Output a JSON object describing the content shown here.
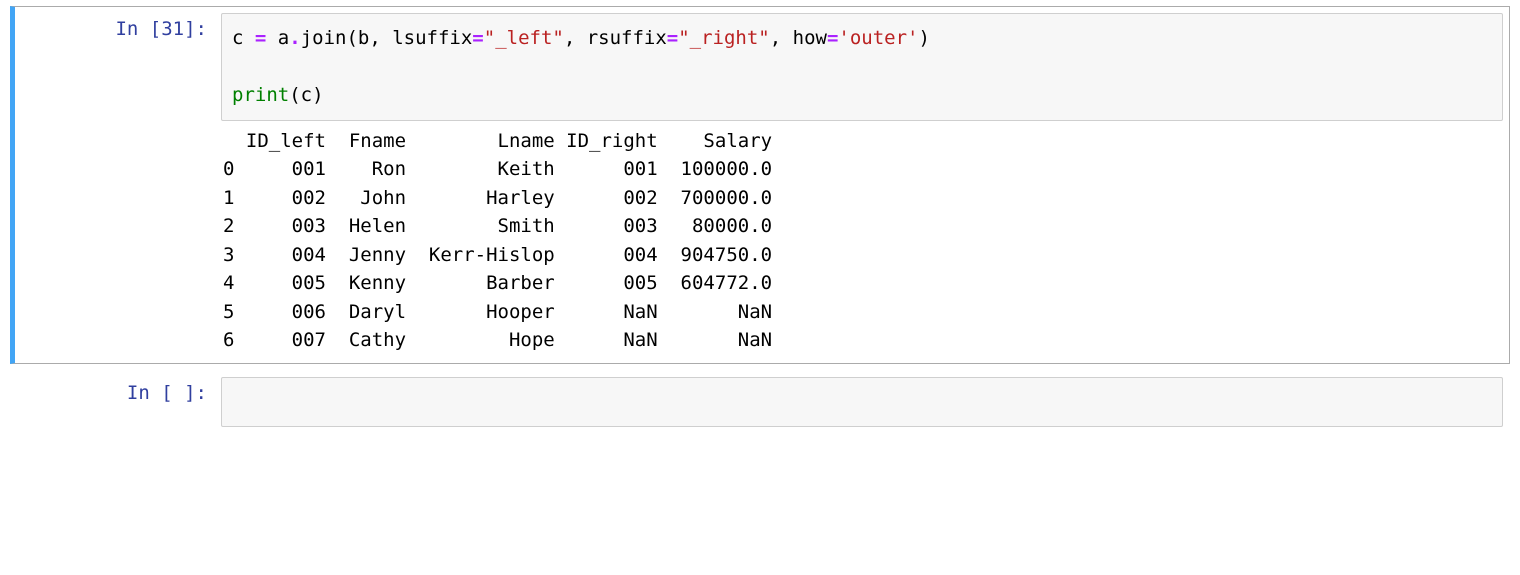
{
  "cells": [
    {
      "prompt": "In [31]:",
      "code_tokens": [
        {
          "t": "c",
          "c": "tok-name"
        },
        {
          "t": " ",
          "c": "tok"
        },
        {
          "t": "=",
          "c": "tok-op"
        },
        {
          "t": " a",
          "c": "tok-name"
        },
        {
          "t": ".",
          "c": "tok-op"
        },
        {
          "t": "join(b, lsuffix",
          "c": "tok-name"
        },
        {
          "t": "=",
          "c": "tok-op"
        },
        {
          "t": "\"_left\"",
          "c": "tok-str"
        },
        {
          "t": ", rsuffix",
          "c": "tok-name"
        },
        {
          "t": "=",
          "c": "tok-op"
        },
        {
          "t": "\"_right\"",
          "c": "tok-str"
        },
        {
          "t": ", how",
          "c": "tok-name"
        },
        {
          "t": "=",
          "c": "tok-op"
        },
        {
          "t": "'outer'",
          "c": "tok-str"
        },
        {
          "t": ")",
          "c": "tok-name"
        },
        {
          "t": "\n\n",
          "c": "tok"
        },
        {
          "t": "print",
          "c": "tok-builtin"
        },
        {
          "t": "(c)",
          "c": "tok-name"
        }
      ],
      "output": "  ID_left  Fname        Lname ID_right    Salary\n0     001    Ron        Keith      001  100000.0\n1     002   John       Harley      002  700000.0\n2     003  Helen        Smith      003   80000.0\n3     004  Jenny  Kerr-Hislop      004  904750.0\n4     005  Kenny       Barber      005  604772.0\n5     006  Daryl       Hooper      NaN       NaN\n6     007  Cathy         Hope      NaN       NaN"
    },
    {
      "prompt": "In [ ]:",
      "code_tokens": [],
      "output": ""
    }
  ]
}
